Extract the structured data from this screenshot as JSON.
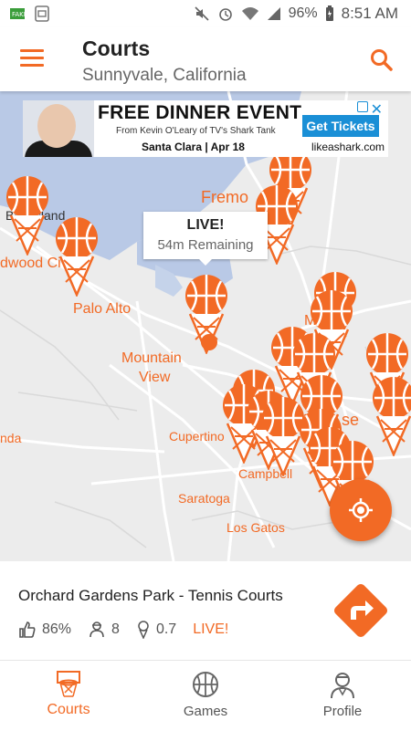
{
  "status_bar": {
    "battery": "96%",
    "time": "8:51 AM"
  },
  "header": {
    "title": "Courts",
    "subtitle": "Sunnyvale, California"
  },
  "ad": {
    "headline": "FREE DINNER EVENT",
    "subline": "From Kevin O'Leary of TV's Shark Tank",
    "meta": "Santa Clara | Apr 18",
    "cta": "Get Tickets",
    "site": "likeashark.com"
  },
  "map": {
    "labels": {
      "bay_island": "Bay Island",
      "redwood_city": "dwood Ci",
      "palo_alto": "Palo Alto",
      "mountain_view_1": "Mountain",
      "mountain_view_2": "View",
      "fremont": "Fremo",
      "milpitas": "Milpi",
      "cupertino": "Cupertino",
      "campbell": "Campbell",
      "saratoga": "Saratoga",
      "los_gatos": "Los Gatos",
      "san_jose": "se",
      "sunnyvale_left": "nda"
    },
    "tooltip": {
      "status": "LIVE!",
      "remaining": "54m Remaining"
    }
  },
  "court": {
    "name": "Orchard Gardens Park - Tennis Courts",
    "rating": "86%",
    "players": "8",
    "distance": "0.7",
    "status": "LIVE!"
  },
  "nav": {
    "items": [
      {
        "label": "Courts"
      },
      {
        "label": "Games"
      },
      {
        "label": "Profile"
      }
    ]
  },
  "colors": {
    "accent": "#f26a25",
    "ad_blue": "#1a8fd6",
    "water": "#b9c9e6"
  }
}
